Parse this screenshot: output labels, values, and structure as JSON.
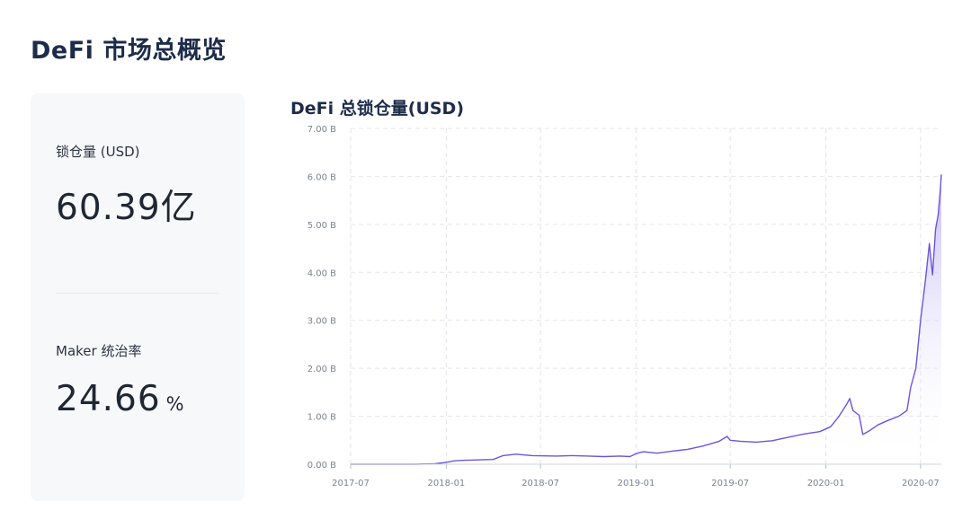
{
  "page": {
    "title": "DeFi 市场总概览"
  },
  "stats": [
    {
      "label": "锁仓量 (USD)",
      "value": "60.39亿",
      "unit": ""
    },
    {
      "label": "Maker 统治率",
      "value": "24.66",
      "unit": "%"
    }
  ],
  "colors": {
    "line": "#6b55e0",
    "fill_top": "#b9aef5",
    "grid": "#e2e5ea",
    "card_bg": "#f7f8fa"
  },
  "chart_data": {
    "type": "area",
    "title": "DeFi 总锁仓量(USD)",
    "xlabel": "",
    "ylabel": "",
    "ylim": [
      0,
      7
    ],
    "xlim": [
      "2017-07-01",
      "2020-08-10"
    ],
    "y_ticks": [
      0,
      1,
      2,
      3,
      4,
      5,
      6,
      7
    ],
    "y_tick_labels": [
      "0.00 B",
      "1.00 B",
      "2.00 B",
      "3.00 B",
      "4.00 B",
      "5.00 B",
      "6.00 B",
      "7.00 B"
    ],
    "x_ticks": [
      "2017-07-01",
      "2018-01-01",
      "2018-07-01",
      "2019-01-01",
      "2019-07-01",
      "2020-01-01",
      "2020-07-01"
    ],
    "x_tick_labels": [
      "2017-07",
      "2018-01",
      "2018-07",
      "2019-01",
      "2019-07",
      "2020-01",
      "2020-07"
    ],
    "grid": true,
    "series": [
      {
        "points": [
          [
            "2017-07-01",
            0.0
          ],
          [
            "2017-09-01",
            0.0
          ],
          [
            "2017-11-01",
            0.0
          ],
          [
            "2017-12-10",
            0.01
          ],
          [
            "2018-01-01",
            0.04
          ],
          [
            "2018-01-15",
            0.07
          ],
          [
            "2018-02-01",
            0.08
          ],
          [
            "2018-03-01",
            0.09
          ],
          [
            "2018-04-01",
            0.1
          ],
          [
            "2018-04-20",
            0.18
          ],
          [
            "2018-05-15",
            0.21
          ],
          [
            "2018-06-15",
            0.18
          ],
          [
            "2018-08-01",
            0.17
          ],
          [
            "2018-09-01",
            0.18
          ],
          [
            "2018-10-01",
            0.17
          ],
          [
            "2018-11-01",
            0.16
          ],
          [
            "2018-12-01",
            0.17
          ],
          [
            "2018-12-20",
            0.16
          ],
          [
            "2019-01-01",
            0.22
          ],
          [
            "2019-01-15",
            0.26
          ],
          [
            "2019-02-10",
            0.23
          ],
          [
            "2019-03-10",
            0.27
          ],
          [
            "2019-04-10",
            0.31
          ],
          [
            "2019-05-10",
            0.38
          ],
          [
            "2019-06-10",
            0.48
          ],
          [
            "2019-06-25",
            0.58
          ],
          [
            "2019-07-01",
            0.5
          ],
          [
            "2019-07-20",
            0.48
          ],
          [
            "2019-08-20",
            0.46
          ],
          [
            "2019-09-20",
            0.49
          ],
          [
            "2019-10-20",
            0.56
          ],
          [
            "2019-11-20",
            0.63
          ],
          [
            "2019-12-20",
            0.68
          ],
          [
            "2020-01-10",
            0.78
          ],
          [
            "2020-01-25",
            0.98
          ],
          [
            "2020-02-10",
            1.25
          ],
          [
            "2020-02-16",
            1.37
          ],
          [
            "2020-02-22",
            1.12
          ],
          [
            "2020-03-05",
            1.02
          ],
          [
            "2020-03-12",
            0.62
          ],
          [
            "2020-03-25",
            0.7
          ],
          [
            "2020-04-10",
            0.82
          ],
          [
            "2020-05-01",
            0.92
          ],
          [
            "2020-05-20",
            1.0
          ],
          [
            "2020-06-05",
            1.12
          ],
          [
            "2020-06-12",
            1.6
          ],
          [
            "2020-06-22",
            2.0
          ],
          [
            "2020-07-01",
            3.0
          ],
          [
            "2020-07-10",
            3.8
          ],
          [
            "2020-07-18",
            4.6
          ],
          [
            "2020-07-24",
            3.95
          ],
          [
            "2020-07-30",
            4.9
          ],
          [
            "2020-08-04",
            5.2
          ],
          [
            "2020-08-08",
            5.7
          ],
          [
            "2020-08-10",
            6.04
          ]
        ]
      }
    ]
  }
}
